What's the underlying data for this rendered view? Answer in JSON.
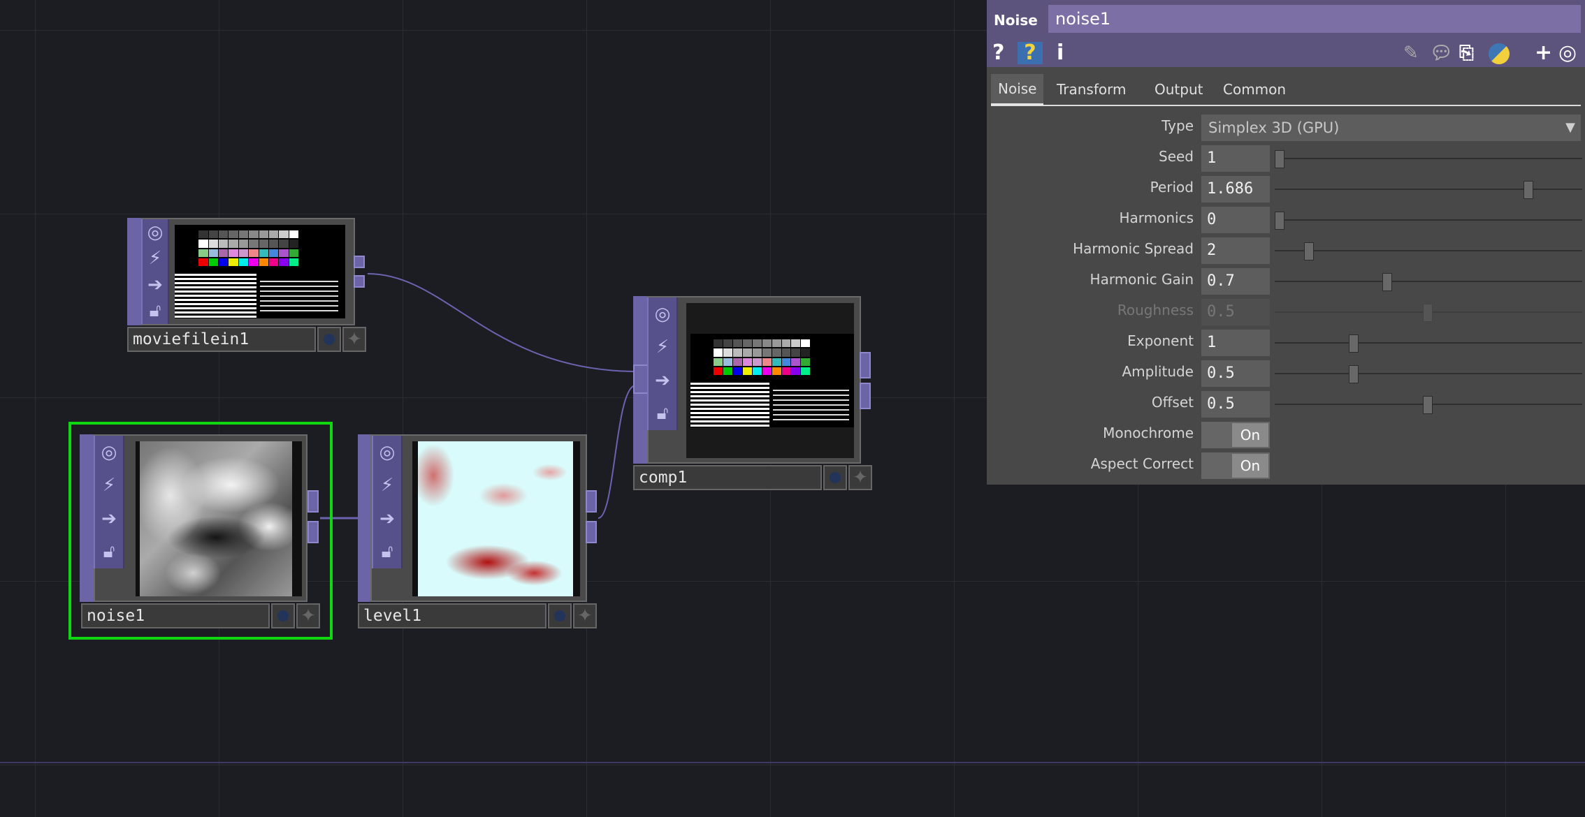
{
  "nodes": {
    "moviefilein": {
      "name": "moviefilein1"
    },
    "noise": {
      "name": "noise1"
    },
    "level": {
      "name": "level1"
    },
    "comp": {
      "name": "comp1"
    }
  },
  "node_button_icons": [
    "viewer-icon",
    "bypass-icon",
    "display-arrow-icon",
    "lock-icon"
  ],
  "panel": {
    "kind": "Noise",
    "name": "noise1",
    "tools_left": [
      "?",
      "?",
      "i"
    ],
    "tabs": [
      "Noise",
      "Transform",
      "Output",
      "Common"
    ],
    "active_tab": "Noise",
    "params": {
      "type": {
        "label": "Type",
        "value": "Simplex 3D (GPU)"
      },
      "seed": {
        "label": "Seed",
        "value": "1"
      },
      "period": {
        "label": "Period",
        "value": "1.686"
      },
      "harmonics": {
        "label": "Harmonics",
        "value": "0"
      },
      "harmonic_spread": {
        "label": "Harmonic Spread",
        "value": "2"
      },
      "harmonic_gain": {
        "label": "Harmonic Gain",
        "value": "0.7"
      },
      "roughness": {
        "label": "Roughness",
        "value": "0.5"
      },
      "exponent": {
        "label": "Exponent",
        "value": "1"
      },
      "amplitude": {
        "label": "Amplitude",
        "value": "0.5"
      },
      "offset": {
        "label": "Offset",
        "value": "0.5"
      },
      "monochrome": {
        "label": "Monochrome",
        "value": "On"
      },
      "aspect_correct": {
        "label": "Aspect Correct",
        "value": "On"
      }
    }
  },
  "colors": {
    "selection": "#10d810",
    "operator_purple": "#6b65a8",
    "panel_header": "#5d547e"
  }
}
